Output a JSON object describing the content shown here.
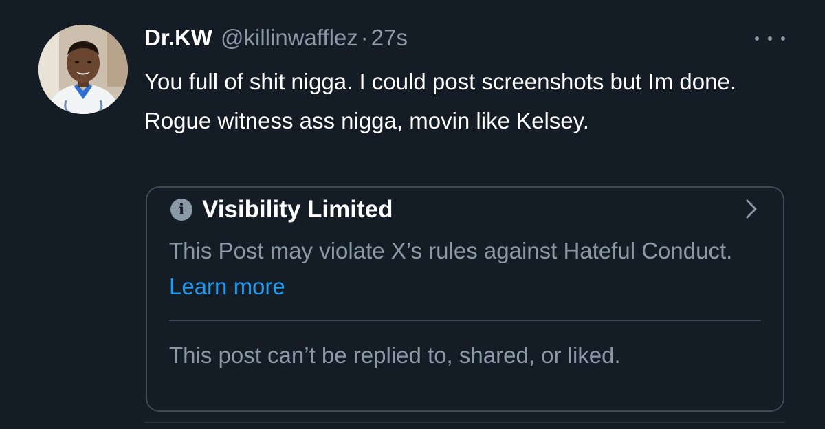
{
  "tweet": {
    "display_name": "Dr.KW",
    "handle": "@killinwafflez",
    "separator": "·",
    "timestamp": "27s",
    "text": "You full of shit nigga. I could post screenshots but Im done. Rogue witness ass nigga, movin like Kelsey.",
    "more_icon": "ellipsis-horizontal-icon",
    "avatar_icon": "profile-photo"
  },
  "visibility_notice": {
    "icon": "info-icon",
    "icon_glyph": "i",
    "title": "Visibility Limited",
    "body": "This Post may violate X’s rules against Hateful Conduct.",
    "link_text": "Learn more",
    "footer": "This post can’t be replied to, shared, or liked.",
    "chevron_icon": "chevron-right-icon"
  },
  "colors": {
    "background": "#141d26",
    "primary_text": "#ffffff",
    "secondary_text": "#8b98a5",
    "link": "#1d9bf0",
    "border": "#3d4a58"
  }
}
